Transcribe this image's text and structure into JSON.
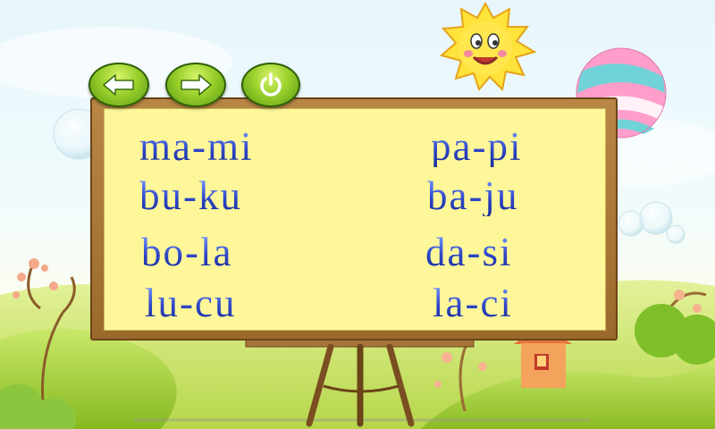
{
  "toolbar": {
    "back_icon": "arrow-left-icon",
    "next_icon": "arrow-right-icon",
    "power_icon": "power-icon"
  },
  "board": {
    "words": [
      [
        "ma-mi",
        "pa-pi"
      ],
      [
        "bu-ku",
        "ba-ju"
      ],
      [
        "bo-la",
        "da-si"
      ],
      [
        "lu-cu",
        "la-ci"
      ]
    ]
  },
  "colors": {
    "board_face": "#fdf79a",
    "board_frame": "#9a6a2c",
    "text_blue": "#2e47c8",
    "button_green": "#8cc63f",
    "sun_yellow": "#ffe23a"
  }
}
